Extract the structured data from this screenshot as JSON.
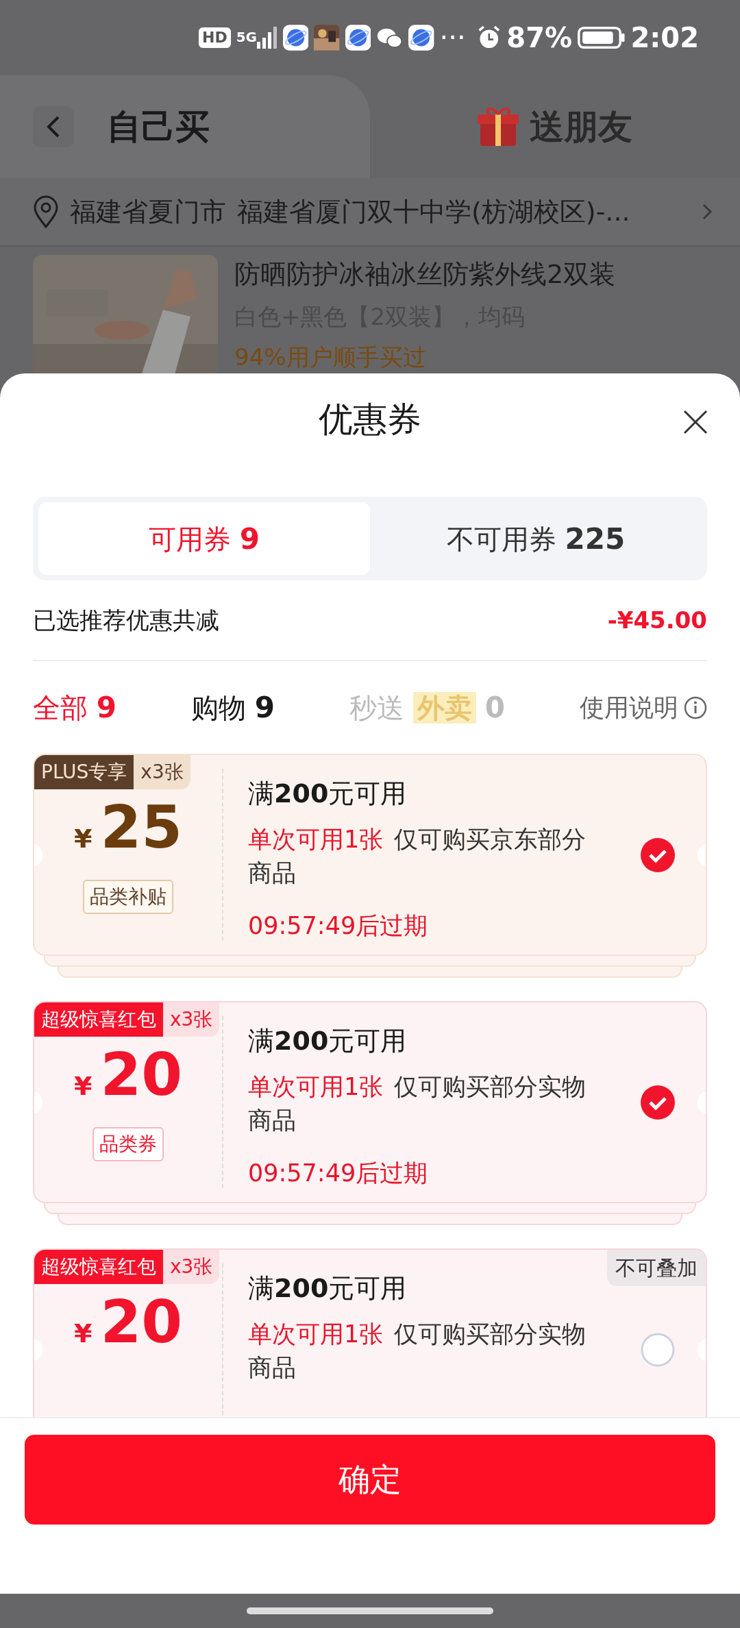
{
  "status_bar": {
    "hd": "HD",
    "network": "5G",
    "more": "···",
    "battery": "87%",
    "time": "2:02"
  },
  "header": {
    "tabs": [
      {
        "label": "自己买",
        "selected": true
      },
      {
        "label": "送朋友",
        "selected": false
      }
    ]
  },
  "address": {
    "region": "福建省夏门市",
    "detail": "福建省厦门双十中学(枋湖校区)-..."
  },
  "product": {
    "title": "防晒防护冰袖冰丝防紫外线2双装",
    "spec": "白色+黑色【2双装】，均码",
    "note": "94%用户顺手买过"
  },
  "sheet": {
    "title": "优惠券",
    "tabs": [
      {
        "label": "可用券",
        "count": "9",
        "selected": true
      },
      {
        "label": "不可用券",
        "count": "225",
        "selected": false
      }
    ],
    "summary": {
      "label": "已选推荐优惠共减",
      "amount": "-¥45.00"
    },
    "filters": [
      {
        "label": "全部",
        "count": "9",
        "selected": true,
        "disabled": false
      },
      {
        "label": "购物",
        "count": "9",
        "selected": false,
        "disabled": false
      },
      {
        "label": "秒送",
        "badge": "外卖",
        "count": "0",
        "selected": false,
        "disabled": true
      }
    ],
    "help": "使用说明",
    "coupons": [
      {
        "kind": "plus",
        "badge": "PLUS专享",
        "quantity": "x3张",
        "currency": "¥",
        "amount": "25",
        "tag": "品类补贴",
        "title": "满**200**元可用",
        "limit": "单次可用1张",
        "scope": "仅可购买京东部分商品",
        "expiry": "09:57:49后过期",
        "selected": true
      },
      {
        "kind": "red",
        "badge": "超级惊喜红包",
        "quantity": "x3张",
        "currency": "¥",
        "amount": "20",
        "tag": "品类券",
        "title": "满**200**元可用",
        "limit": "单次可用1张",
        "scope": "仅可购买部分实物商品",
        "expiry": "09:57:49后过期",
        "selected": true
      },
      {
        "kind": "red",
        "badge": "超级惊喜红包",
        "quantity": "x3张",
        "currency": "¥",
        "amount": "20",
        "title": "满**200**元可用",
        "limit": "单次可用1张",
        "scope": "仅可购买部分实物商品",
        "stack_note": "不可叠加",
        "selected": false
      }
    ],
    "confirm": "确定"
  }
}
